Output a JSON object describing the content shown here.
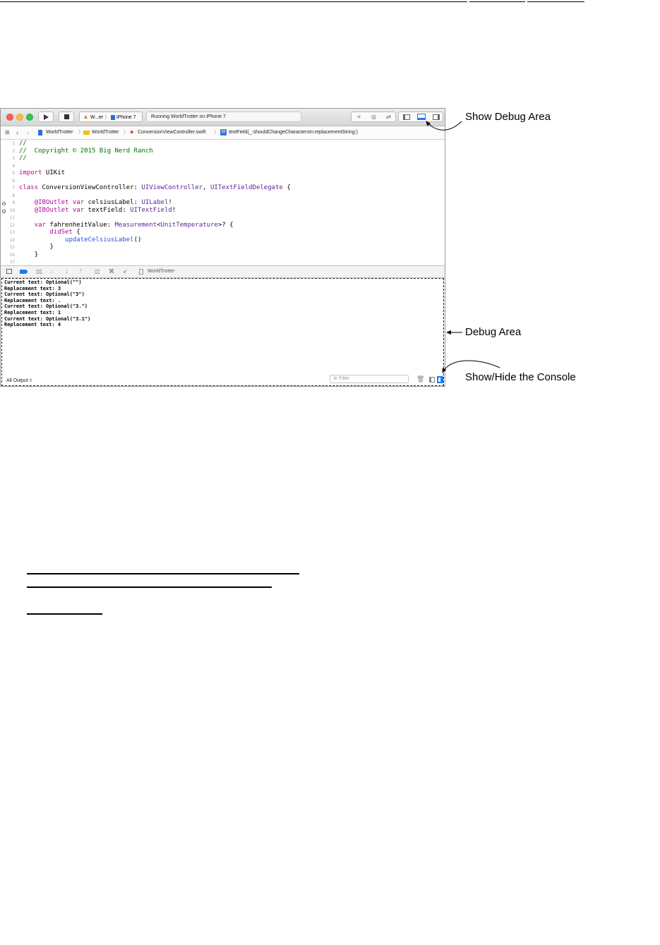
{
  "toolbar": {
    "scheme_target": "W...er",
    "scheme_device": "iPhone 7",
    "activity_status": "Running WorldTrotter on iPhone 7"
  },
  "jump_bar": {
    "items": [
      "WorldTrotter",
      "WorldTrotter",
      "ConversionViewController.swift",
      "textField(_:shouldChangeCharactersIn:replacementString:)"
    ]
  },
  "editor": {
    "line_numbers": [
      "1",
      "2",
      "3",
      "4",
      "5",
      "6",
      "7",
      "8",
      "9",
      "10",
      "11",
      "12",
      "13",
      "14",
      "15",
      "16",
      "17"
    ],
    "lines": [
      "//",
      "//  Copyright © 2015 Big Nerd Ranch",
      "//",
      "",
      "import UIKit",
      "",
      "class ConversionViewController: UIViewController, UITextFieldDelegate {",
      "",
      "    @IBOutlet var celsiusLabel: UILabel!",
      "    @IBOutlet var textField: UITextField!",
      "",
      "    var fahrenheitValue: Measurement<UnitTemperature>? {",
      "        didSet {",
      "            updateCelsiusLabel()",
      "        }",
      "    }",
      ""
    ]
  },
  "debug_bar": {
    "target_label": "WorldTrotter"
  },
  "console": {
    "lines": [
      "Current text: Optional(\"\")",
      "Replacement text: 3",
      "Current text: Optional(\"3\")",
      "Replacement text: .",
      "Current text: Optional(\"3.\")",
      "Replacement text: 1",
      "Current text: Optional(\"3.1\")",
      "Replacement text: 4"
    ],
    "output_selector": "All Output ◊",
    "filter_placeholder": "Filter"
  },
  "callouts": {
    "show_debug_area": "Show Debug Area",
    "debug_area": "Debug Area",
    "show_hide_console": "Show/Hide the Console"
  },
  "colors": {
    "keyword": "#aa0d91",
    "comment": "#007400",
    "type": "#5c2699",
    "accent": "#1d7af2"
  }
}
